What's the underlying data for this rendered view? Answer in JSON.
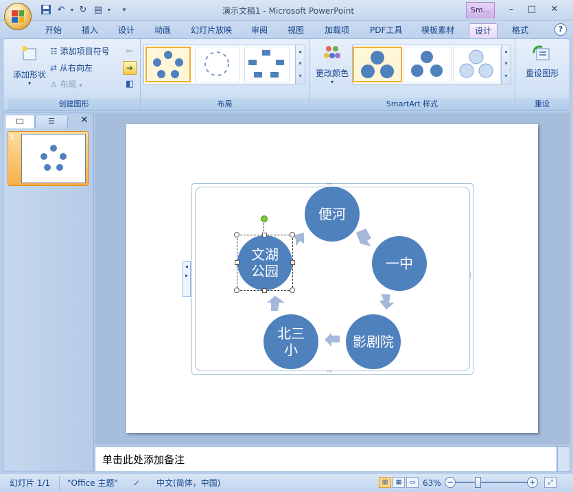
{
  "titlebar": {
    "title": "演示文稿1 - Microsoft PowerPoint",
    "context_tab_title": "Sm...",
    "minimize": "–",
    "maximize": "□",
    "close": "✕"
  },
  "tabs": [
    "开始",
    "插入",
    "设计",
    "动画",
    "幻灯片放映",
    "审阅",
    "视图",
    "加载项",
    "PDF工具",
    "模板素材",
    "设计",
    "格式"
  ],
  "ribbon": {
    "create_graphic": {
      "label": "创建图形",
      "add_shape": "添加形状",
      "add_bullet": "添加项目符号",
      "right_to_left": "从右向左",
      "layout": "布局"
    },
    "layouts": {
      "label": "布局"
    },
    "styles": {
      "label": "SmartArt 样式",
      "change_colors": "更改颜色"
    },
    "reset": {
      "label": "重设",
      "reset_graphic": "重设图形"
    }
  },
  "slide_panel": {
    "slide_number": "1"
  },
  "smartart": {
    "nodes": [
      "便河",
      "一中",
      "影剧院",
      "北三小",
      "文湖公园"
    ],
    "node_color": "#4f81bd",
    "arrow_color": "#a6b8d8"
  },
  "notes": {
    "placeholder": "单击此处添加备注"
  },
  "statusbar": {
    "slide_info": "幻灯片 1/1",
    "theme": "\"Office 主题\"",
    "language": "中文(简体，中国)",
    "zoom": "63%"
  }
}
